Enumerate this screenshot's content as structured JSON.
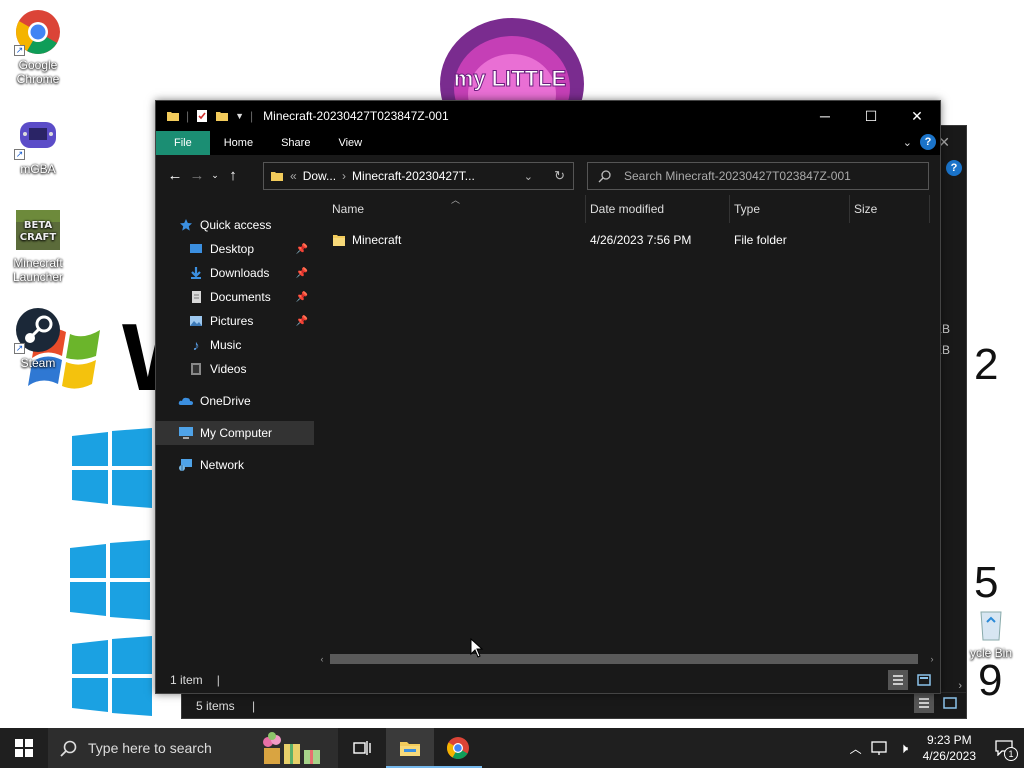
{
  "desktop": {
    "icons": [
      {
        "label": "Google Chrome",
        "icon": "chrome-icon"
      },
      {
        "label": "mGBA",
        "icon": "mgba-icon"
      },
      {
        "label": "Minecraft Launcher",
        "icon": "beta-craft-icon",
        "logo_text": "BETA CRAFT"
      },
      {
        "label": "Steam",
        "icon": "steam-icon"
      },
      {
        "label": "Recycle Bin",
        "icon": "recycle-bin-icon",
        "visible_text": "ycle Bin"
      }
    ],
    "wallpaper": {
      "logo_text": "my LITTLE",
      "big_letter": "W",
      "numbers": [
        "2",
        "5",
        "9"
      ]
    }
  },
  "back_window": {
    "status_text": "5 items",
    "size_fragments": [
      "KB",
      "KB"
    ]
  },
  "explorer": {
    "title": "Minecraft-20230427T023847Z-001",
    "tabs": [
      "File",
      "Home",
      "Share",
      "View"
    ],
    "window_controls": {
      "minimize": "─",
      "maximize": "☐",
      "close": "✕"
    },
    "address": {
      "ellipsis": "«",
      "segments": [
        "Dow...",
        "Minecraft-20230427T..."
      ]
    },
    "search_placeholder": "Search Minecraft-20230427T023847Z-001",
    "nav_pane": [
      {
        "label": "Quick access",
        "icon": "star-icon",
        "level": 1
      },
      {
        "label": "Desktop",
        "icon": "desktop-folder-icon",
        "level": 2,
        "pinned": true
      },
      {
        "label": "Downloads",
        "icon": "downloads-icon",
        "level": 2,
        "pinned": true
      },
      {
        "label": "Documents",
        "icon": "documents-icon",
        "level": 2,
        "pinned": true
      },
      {
        "label": "Pictures",
        "icon": "pictures-icon",
        "level": 2,
        "pinned": true
      },
      {
        "label": "Music",
        "icon": "music-icon",
        "level": 2
      },
      {
        "label": "Videos",
        "icon": "videos-icon",
        "level": 2
      },
      {
        "label": "OneDrive",
        "icon": "onedrive-icon",
        "level": 1
      },
      {
        "label": "My Computer",
        "icon": "computer-icon",
        "level": 1,
        "selected": true
      },
      {
        "label": "Network",
        "icon": "network-icon",
        "level": 1
      }
    ],
    "columns": [
      "Name",
      "Date modified",
      "Type",
      "Size"
    ],
    "files": [
      {
        "name": "Minecraft",
        "date_modified": "4/26/2023 7:56 PM",
        "type": "File folder",
        "size": ""
      }
    ],
    "status_text": "1 item",
    "status_sep": "|"
  },
  "taskbar": {
    "search_placeholder": "Type here to search",
    "clock_time": "9:23 PM",
    "clock_date": "4/26/2023",
    "notification_count": "1"
  },
  "colors": {
    "file_tab": "#1b8e73",
    "help_badge": "#1a73c9",
    "window_bg": "#191919",
    "taskbar_bg": "#1f1f1f"
  }
}
